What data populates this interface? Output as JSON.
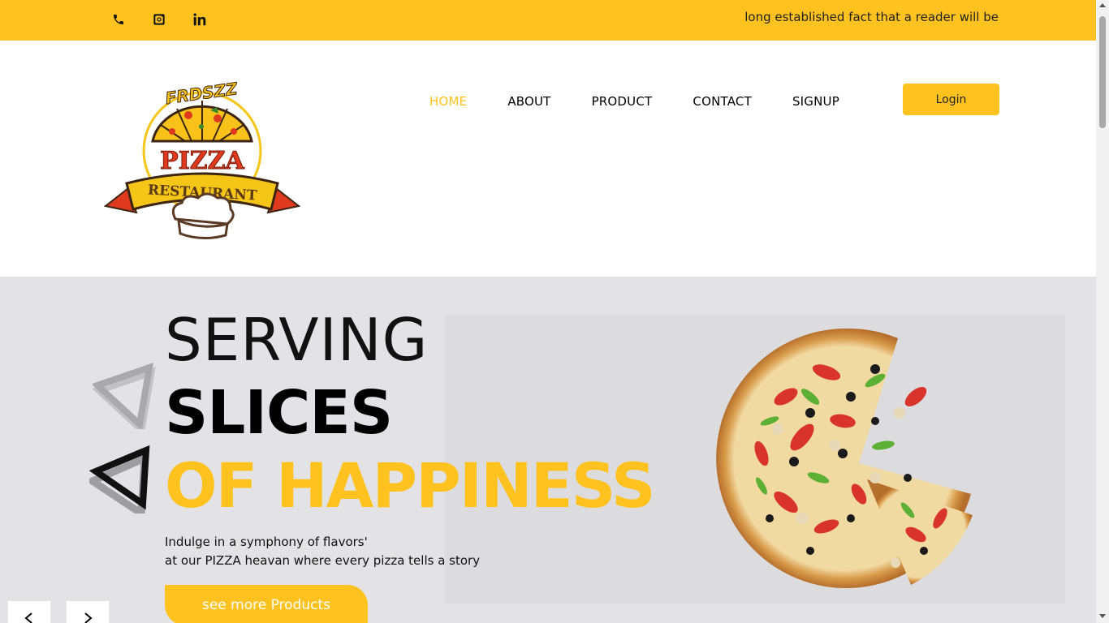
{
  "topbar": {
    "icons": [
      "phone-icon",
      "instagram-icon",
      "linkedin-icon"
    ],
    "tagline": "long established fact that a reader will be"
  },
  "logo": {
    "brand_text": "FRDSZZ",
    "pizza_text": "PIZZA",
    "restaurant_text": "RESTAURANT"
  },
  "nav": {
    "items": [
      {
        "label": "HOME",
        "active": true
      },
      {
        "label": "ABOUT",
        "active": false
      },
      {
        "label": "PRODUCT",
        "active": false
      },
      {
        "label": "CONTACT",
        "active": false
      },
      {
        "label": "SIGNUP",
        "active": false
      }
    ],
    "login_label": "Login"
  },
  "hero": {
    "line1": "SERVING",
    "line2": "SLICES",
    "line3": "OF HAPPINESS",
    "desc_line1": "Indulge in a symphony of flavors'",
    "desc_line2": "at our PIZZA heavan where every pizza tells a story",
    "cta_label": "see more Products"
  },
  "colors": {
    "accent": "#ffc21f",
    "hero_bg": "#e3e2e4"
  }
}
